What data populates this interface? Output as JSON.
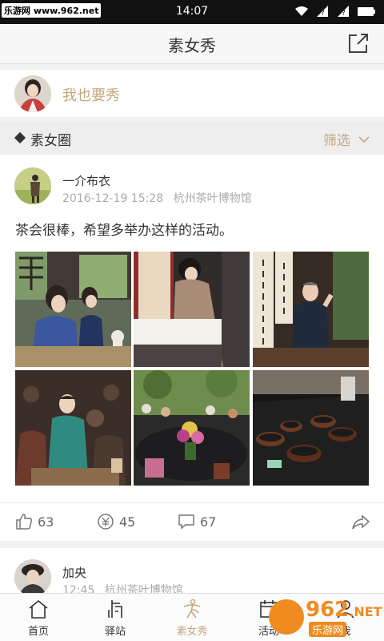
{
  "status_bar": {
    "watermark": "乐游网 www.962.net",
    "time": "14:07"
  },
  "nav": {
    "title": "素女秀",
    "share_icon": "share-out-icon"
  },
  "post_entry": {
    "prompt": "我也要秀"
  },
  "section": {
    "title": "素女圈",
    "filter_label": "筛选"
  },
  "post": {
    "username": "一介布衣",
    "timestamp": "2016-12-19 15:28",
    "location": "杭州茶叶博物馆",
    "text": "茶会很棒，希望多举办这样的活动。",
    "likes": "63",
    "coins": "45",
    "comments": "67"
  },
  "post2": {
    "username": "加央",
    "timestamp": "12:45",
    "location": "杭州茶叶博物馆"
  },
  "tabs": [
    {
      "label": "首页",
      "icon": "home-icon"
    },
    {
      "label": "驿站",
      "icon": "station-icon"
    },
    {
      "label": "素女秀",
      "icon": "dancer-icon"
    },
    {
      "label": "活动",
      "icon": "activity-icon"
    },
    {
      "label": "我",
      "icon": "profile-icon"
    }
  ],
  "watermark_br": {
    "number": "962",
    "net": ".NET",
    "sub": "乐游网"
  },
  "colors": {
    "accent": "#c4a77f",
    "status_bar": "#111111",
    "watermark": "#f08b20"
  }
}
